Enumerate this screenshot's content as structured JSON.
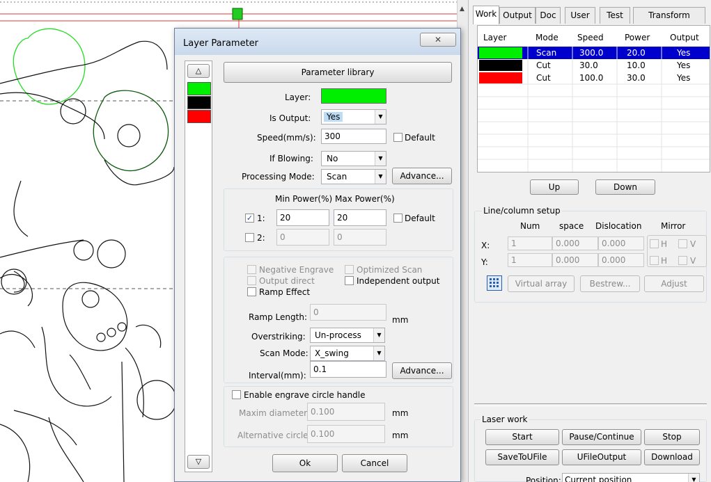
{
  "tabs": [
    "Work",
    "Output",
    "Doc",
    "User",
    "Test",
    "Transform"
  ],
  "layer_table": {
    "headers": [
      "Layer",
      "Mode",
      "Speed",
      "Power",
      "Output"
    ],
    "rows": [
      {
        "color": "#00ee00",
        "mode": "Scan",
        "speed": "300.0",
        "power": "20.0",
        "output": "Yes",
        "selected": true
      },
      {
        "color": "#000000",
        "mode": "Cut",
        "speed": "30.0",
        "power": "10.0",
        "output": "Yes",
        "selected": false
      },
      {
        "color": "#ff0000",
        "mode": "Cut",
        "speed": "100.0",
        "power": "30.0",
        "output": "Yes",
        "selected": false
      }
    ]
  },
  "up_label": "Up",
  "down_label": "Down",
  "line_setup": {
    "title": "Line/column setup",
    "col_num": "Num",
    "col_space": "space",
    "col_dislocation": "Dislocation",
    "col_mirror": "Mirror",
    "x_label": "X:",
    "y_label": "Y:",
    "x_num": "1",
    "x_space": "0.000",
    "x_dislocation": "0.000",
    "y_num": "1",
    "y_space": "0.000",
    "y_dislocation": "0.000",
    "mirror_h": "H",
    "mirror_v": "V",
    "virtual_array": "Virtual array",
    "bestrew": "Bestrew...",
    "adjust": "Adjust"
  },
  "laser_work": {
    "title": "Laser work",
    "start": "Start",
    "pause": "Pause/Continue",
    "stop": "Stop",
    "save_u": "SaveToUFile",
    "ufile_output": "UFileOutput",
    "download": "Download",
    "position_label": "Position:",
    "position_value": "Current position"
  },
  "dialog": {
    "title": "Layer Parameter",
    "close": "✕",
    "parameter_library": "Parameter library",
    "layer_label": "Layer:",
    "layer_color": "#00ee00",
    "is_output_label": "Is Output:",
    "is_output_value": "Yes",
    "speed_label": "Speed(mm/s):",
    "speed_value": "300",
    "default_label": "Default",
    "if_blowing_label": "If Blowing:",
    "if_blowing_value": "No",
    "processing_mode_label": "Processing Mode:",
    "processing_mode_value": "Scan",
    "advance_label": "Advance...",
    "min_power_label": "Min Power(%)",
    "max_power_label": "Max Power(%)",
    "p1_label": "1:",
    "p1_min": "20",
    "p1_max": "20",
    "p2_label": "2:",
    "p2_min": "0",
    "p2_max": "0",
    "negative_engrave": "Negative Engrave",
    "optimized_scan": "Optimized Scan",
    "output_direct": "Output direct",
    "independent_output": "Independent output",
    "ramp_effect": "Ramp Effect",
    "ramp_length_label": "Ramp Length:",
    "ramp_length_value": "0",
    "mm": "mm",
    "overstriking_label": "Overstriking:",
    "overstriking_value": "Un-process",
    "scan_mode_label": "Scan Mode:",
    "scan_mode_value": "X_swing",
    "interval_label": "Interval(mm):",
    "interval_value": "0.1",
    "enable_circle": "Enable engrave circle handle",
    "maxim_diameter_label": "Maxim diameter:",
    "maxim_diameter_value": "0.100",
    "alt_circle_label": "Alternative circle",
    "alt_circle_value": "0.100",
    "ok": "Ok",
    "cancel": "Cancel",
    "layer_colors": [
      "#00ee00",
      "#000000",
      "#ff0000"
    ]
  }
}
